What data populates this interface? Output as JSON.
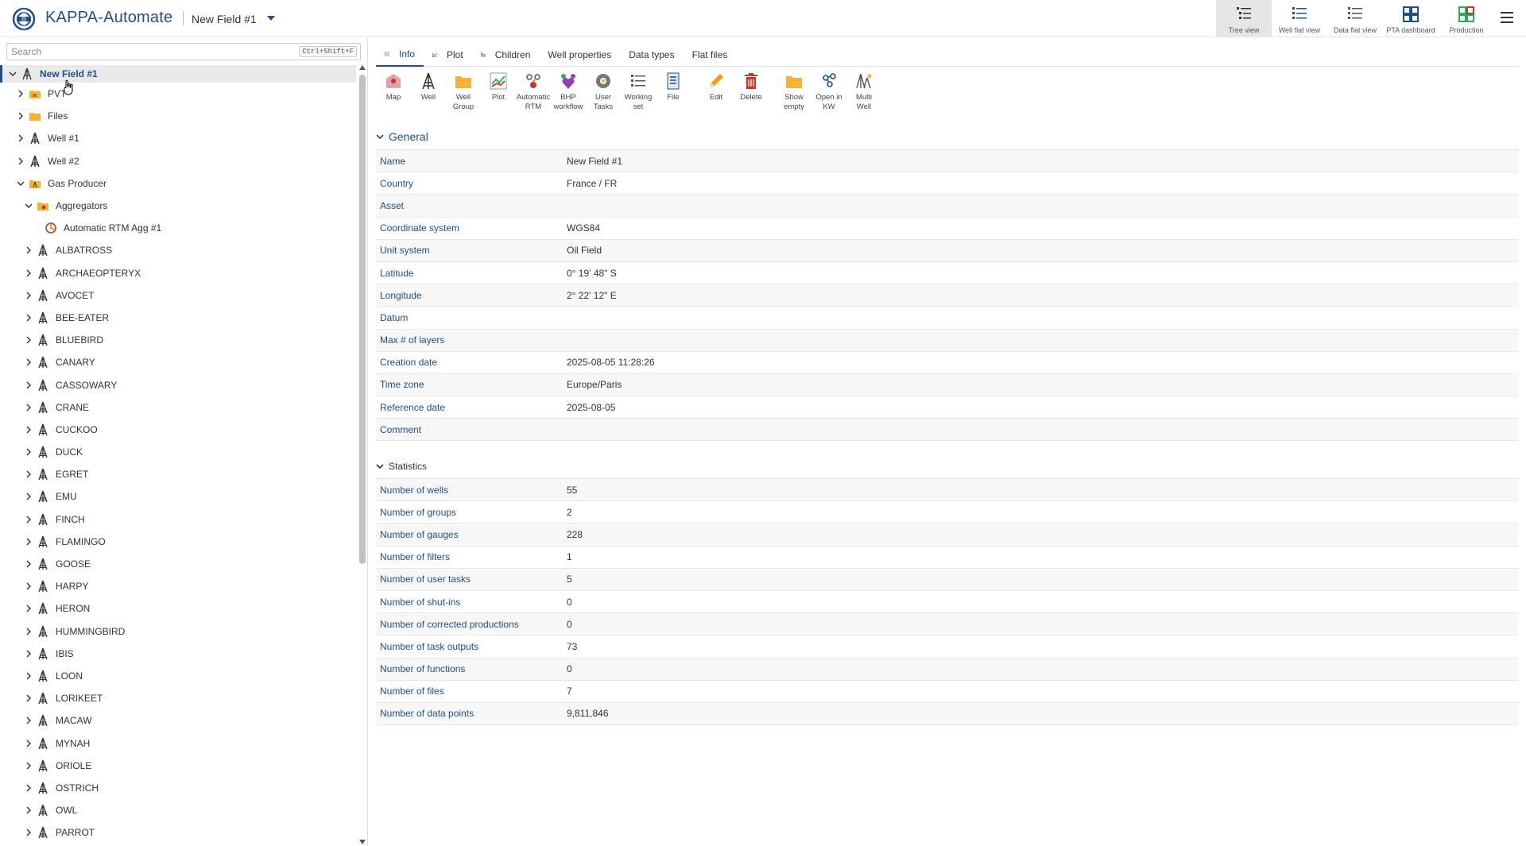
{
  "header": {
    "app_name": "KAPPA-Automate",
    "field_name": "New Field #1",
    "views": [
      {
        "label": "Tree view",
        "icon": "tree-view-icon",
        "active": true
      },
      {
        "label": "Well flat view",
        "icon": "well-flat-view-icon",
        "active": false
      },
      {
        "label": "Data flat view",
        "icon": "data-flat-view-icon",
        "active": false
      },
      {
        "label": "PTA dashboard",
        "icon": "pta-dashboard-icon",
        "active": false
      },
      {
        "label": "Production",
        "icon": "production-icon",
        "active": false
      }
    ]
  },
  "sidebar": {
    "search_placeholder": "Search",
    "search_shortcut": "Ctrl+Shift+F",
    "tree": [
      {
        "label": "New Field #1",
        "level": 0,
        "expanded": true,
        "icon": "field-icon",
        "selected": true
      },
      {
        "label": "PVT",
        "level": 1,
        "expanded": false,
        "icon": "pvt-folder-icon"
      },
      {
        "label": "Files",
        "level": 1,
        "expanded": false,
        "icon": "files-folder-icon"
      },
      {
        "label": "Well #1",
        "level": 1,
        "expanded": false,
        "icon": "well-icon"
      },
      {
        "label": "Well #2",
        "level": 1,
        "expanded": false,
        "icon": "well-icon"
      },
      {
        "label": "Gas Producer",
        "level": 1,
        "expanded": true,
        "icon": "group-folder-icon"
      },
      {
        "label": "Aggregators",
        "level": 2,
        "expanded": true,
        "icon": "aggregators-folder-icon"
      },
      {
        "label": "Automatic RTM Agg #1",
        "level": 3,
        "expanded": null,
        "icon": "aggregator-icon"
      },
      {
        "label": "ALBATROSS",
        "level": 2,
        "expanded": false,
        "icon": "well-icon"
      },
      {
        "label": "ARCHAEOPTERYX",
        "level": 2,
        "expanded": false,
        "icon": "well-icon"
      },
      {
        "label": "AVOCET",
        "level": 2,
        "expanded": false,
        "icon": "well-icon"
      },
      {
        "label": "BEE-EATER",
        "level": 2,
        "expanded": false,
        "icon": "well-icon"
      },
      {
        "label": "BLUEBIRD",
        "level": 2,
        "expanded": false,
        "icon": "well-icon"
      },
      {
        "label": "CANARY",
        "level": 2,
        "expanded": false,
        "icon": "well-icon"
      },
      {
        "label": "CASSOWARY",
        "level": 2,
        "expanded": false,
        "icon": "well-icon"
      },
      {
        "label": "CRANE",
        "level": 2,
        "expanded": false,
        "icon": "well-icon"
      },
      {
        "label": "CUCKOO",
        "level": 2,
        "expanded": false,
        "icon": "well-icon"
      },
      {
        "label": "DUCK",
        "level": 2,
        "expanded": false,
        "icon": "well-icon"
      },
      {
        "label": "EGRET",
        "level": 2,
        "expanded": false,
        "icon": "well-icon"
      },
      {
        "label": "EMU",
        "level": 2,
        "expanded": false,
        "icon": "well-icon"
      },
      {
        "label": "FINCH",
        "level": 2,
        "expanded": false,
        "icon": "well-icon"
      },
      {
        "label": "FLAMINGO",
        "level": 2,
        "expanded": false,
        "icon": "well-icon"
      },
      {
        "label": "GOOSE",
        "level": 2,
        "expanded": false,
        "icon": "well-icon"
      },
      {
        "label": "HARPY",
        "level": 2,
        "expanded": false,
        "icon": "well-icon"
      },
      {
        "label": "HERON",
        "level": 2,
        "expanded": false,
        "icon": "well-icon"
      },
      {
        "label": "HUMMINGBIRD",
        "level": 2,
        "expanded": false,
        "icon": "well-icon"
      },
      {
        "label": "IBIS",
        "level": 2,
        "expanded": false,
        "icon": "well-icon"
      },
      {
        "label": "LOON",
        "level": 2,
        "expanded": false,
        "icon": "well-icon"
      },
      {
        "label": "LORIKEET",
        "level": 2,
        "expanded": false,
        "icon": "well-icon"
      },
      {
        "label": "MACAW",
        "level": 2,
        "expanded": false,
        "icon": "well-icon"
      },
      {
        "label": "MYNAH",
        "level": 2,
        "expanded": false,
        "icon": "well-icon"
      },
      {
        "label": "ORIOLE",
        "level": 2,
        "expanded": false,
        "icon": "well-icon"
      },
      {
        "label": "OSTRICH",
        "level": 2,
        "expanded": false,
        "icon": "well-icon"
      },
      {
        "label": "OWL",
        "level": 2,
        "expanded": false,
        "icon": "well-icon"
      },
      {
        "label": "PARROT",
        "level": 2,
        "expanded": false,
        "icon": "well-icon"
      }
    ]
  },
  "main": {
    "tabs": [
      {
        "label": "Info",
        "icon": "list-icon",
        "active": true
      },
      {
        "label": "Plot",
        "icon": "plot-icon",
        "active": false
      },
      {
        "label": "Children",
        "icon": "children-icon",
        "active": false
      },
      {
        "label": "Well properties",
        "icon": "",
        "active": false
      },
      {
        "label": "Data types",
        "icon": "",
        "active": false
      },
      {
        "label": "Flat files",
        "icon": "",
        "active": false
      }
    ],
    "toolbar": [
      {
        "lines": [
          "Map"
        ],
        "icon": "map-icon"
      },
      {
        "lines": [
          "Well"
        ],
        "icon": "well-tool-icon"
      },
      {
        "lines": [
          "Well",
          "Group"
        ],
        "icon": "well-group-icon"
      },
      {
        "lines": [
          "Plot"
        ],
        "icon": "plot-tool-icon"
      },
      {
        "lines": [
          "Automatic",
          "RTM"
        ],
        "icon": "automatic-rtm-icon"
      },
      {
        "lines": [
          "BHP",
          "workflow"
        ],
        "icon": "bhp-workflow-icon"
      },
      {
        "lines": [
          "User",
          "Tasks"
        ],
        "icon": "user-tasks-icon"
      },
      {
        "lines": [
          "Working",
          "set"
        ],
        "icon": "working-set-icon"
      },
      {
        "lines": [
          "File"
        ],
        "icon": "file-icon"
      },
      {
        "gap": true
      },
      {
        "lines": [
          "Edit"
        ],
        "icon": "edit-icon"
      },
      {
        "lines": [
          "Delete"
        ],
        "icon": "delete-icon"
      },
      {
        "gap": true
      },
      {
        "lines": [
          "Show",
          "empty"
        ],
        "icon": "show-empty-icon"
      },
      {
        "lines": [
          "Open in",
          "KW"
        ],
        "icon": "open-in-kw-icon"
      },
      {
        "lines": [
          "Multi",
          "Well"
        ],
        "icon": "multi-well-icon"
      }
    ],
    "general": {
      "title": "General",
      "rows": [
        {
          "key": "Name",
          "value": "New Field #1"
        },
        {
          "key": "Country",
          "value": "France / FR"
        },
        {
          "key": "Asset",
          "value": ""
        },
        {
          "key": "Coordinate system",
          "value": "WGS84"
        },
        {
          "key": "Unit system",
          "value": "Oil Field"
        },
        {
          "key": "Latitude",
          "value": "0° 19' 48\" S"
        },
        {
          "key": "Longitude",
          "value": "2° 22' 12\" E"
        },
        {
          "key": "Datum",
          "value": ""
        },
        {
          "key": "Max # of layers",
          "value": ""
        },
        {
          "key": "Creation date",
          "value": "2025-08-05 11:28:26"
        },
        {
          "key": "Time zone",
          "value": "Europe/Paris"
        },
        {
          "key": "Reference date",
          "value": "2025-08-05"
        },
        {
          "key": "Comment",
          "value": ""
        }
      ]
    },
    "statistics": {
      "title": "Statistics",
      "rows": [
        {
          "key": "Number of wells",
          "value": "55"
        },
        {
          "key": "Number of groups",
          "value": "2"
        },
        {
          "key": "Number of gauges",
          "value": "228"
        },
        {
          "key": "Number of filters",
          "value": "1"
        },
        {
          "key": "Number of user tasks",
          "value": "5"
        },
        {
          "key": "Number of shut-ins",
          "value": "0"
        },
        {
          "key": "Number of corrected productions",
          "value": "0"
        },
        {
          "key": "Number of task outputs",
          "value": "73"
        },
        {
          "key": "Number of functions",
          "value": "0"
        },
        {
          "key": "Number of files",
          "value": "7"
        },
        {
          "key": "Number of data points",
          "value": "9,811,846"
        }
      ]
    }
  },
  "colors": {
    "brand": "#1f4e8c",
    "well_icon": "#333333",
    "folder": "#f5b335",
    "delete": "#c0392b",
    "edit": "#f39c12"
  }
}
